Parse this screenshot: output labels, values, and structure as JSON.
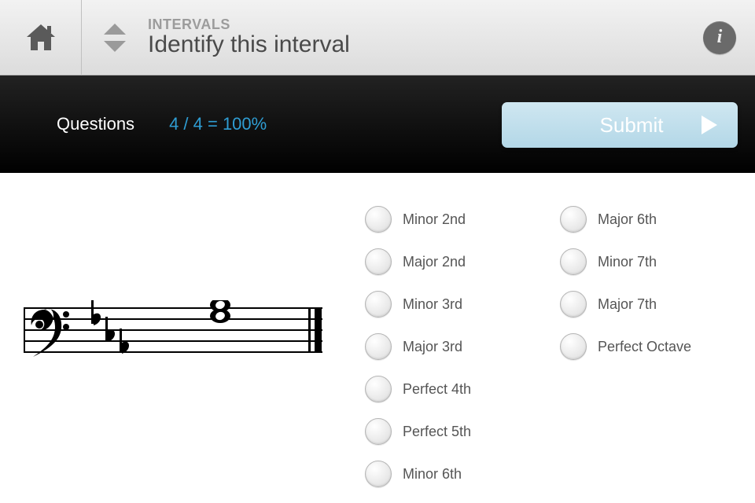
{
  "header": {
    "category": "INTERVALS",
    "title": "Identify this interval"
  },
  "statusbar": {
    "questions_label": "Questions",
    "score_text": "4 / 4 = 100%",
    "submit_label": "Submit"
  },
  "answers": {
    "col1": [
      "Minor 2nd",
      "Major 2nd",
      "Minor 3rd",
      "Major 3rd",
      "Perfect 4th",
      "Perfect 5th",
      "Minor 6th"
    ],
    "col2": [
      "Major 6th",
      "Minor 7th",
      "Major 7th",
      "Perfect Octave"
    ]
  },
  "notation": {
    "clef": "bass",
    "key_signature_flat_count": 3,
    "interval_display": "stacked-third"
  },
  "icons": {
    "home": "home-icon",
    "nav": "updown-icon",
    "info": "info-icon",
    "submit_arrow": "play-arrow-icon"
  }
}
